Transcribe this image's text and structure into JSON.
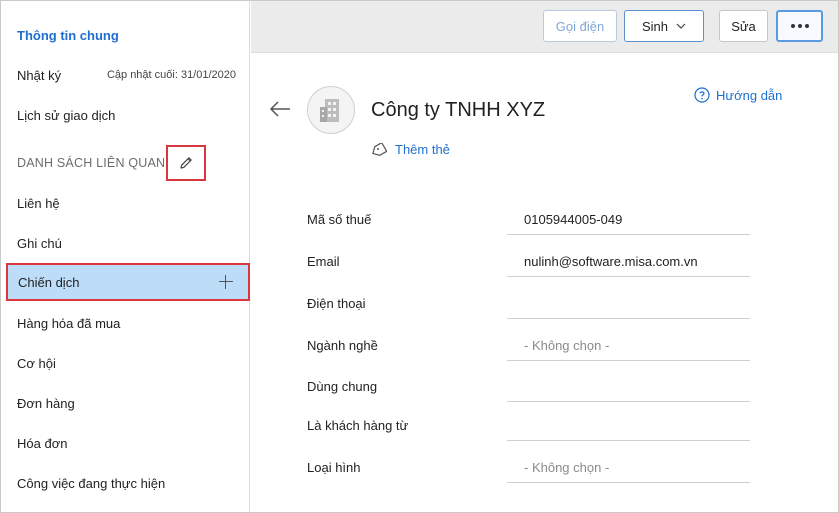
{
  "sidebar": {
    "title": "Thông tin chung",
    "diary": {
      "label": "Nhật ký",
      "meta": "Cập nhật cuối: 31/01/2020"
    },
    "history": "Lịch sử giao dịch",
    "section": "DANH SÁCH LIÊN QUAN",
    "items": [
      {
        "label": "Liên hệ"
      },
      {
        "label": "Ghi chú"
      },
      {
        "label": "Chiến dịch"
      },
      {
        "label": "Hàng hóa đã mua"
      },
      {
        "label": "Cơ hội"
      },
      {
        "label": "Đơn hàng"
      },
      {
        "label": "Hóa đơn"
      },
      {
        "label": "Công việc đang thực hiện"
      }
    ]
  },
  "toolbar": {
    "call_label": "Gọi điện",
    "sinh_label": "Sinh",
    "edit_label": "Sửa"
  },
  "record": {
    "name": "Công ty TNHH XYZ",
    "help_label": "Hướng dẫn",
    "add_tag_label": "Thêm thẻ"
  },
  "fields": [
    {
      "label": "Mã số thuế",
      "value": "0105944005-049"
    },
    {
      "label": "Email",
      "value": "nulinh@software.misa.com.vn"
    },
    {
      "label": "Điện thoại",
      "value": ""
    },
    {
      "label": "Ngành nghề",
      "value": "- Không chọn -"
    },
    {
      "label": "Dùng chung",
      "value": ""
    },
    {
      "label": "Là khách hàng từ",
      "value": ""
    },
    {
      "label": "Loại hình",
      "value": "- Không chọn -"
    }
  ],
  "colors": {
    "accent": "#1e6fd0",
    "active_bg": "#bcdcf7",
    "highlight_border": "#d9363e",
    "toolbar_bg": "#ebebeb"
  }
}
